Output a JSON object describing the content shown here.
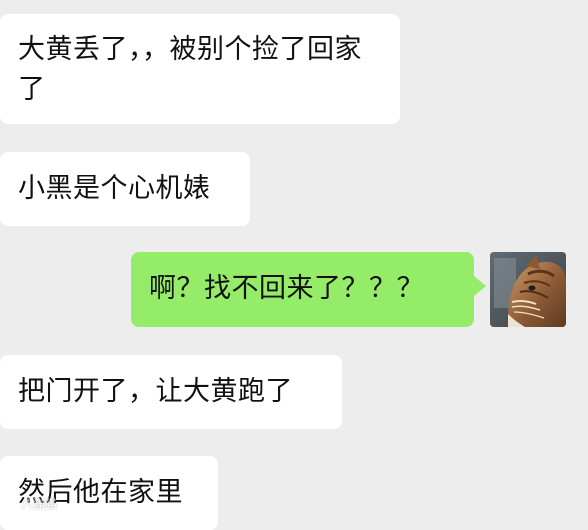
{
  "messages": [
    {
      "id": "m1",
      "sender": "other",
      "text": "大黄丢了，，被别个捡了回家了"
    },
    {
      "id": "m2",
      "sender": "other",
      "text": "小黑是个心机婊"
    },
    {
      "id": "m3",
      "sender": "me",
      "text": "啊？找不回来了？？？"
    },
    {
      "id": "m4",
      "sender": "other",
      "text": "把门开了，让大黄跑了"
    },
    {
      "id": "m5",
      "sender": "other",
      "text": "然后他在家里"
    }
  ],
  "colors": {
    "background": "#ededed",
    "received_bubble": "#ffffff",
    "sent_bubble": "#95ec69",
    "text": "#111111"
  },
  "avatar": {
    "icon": "cat-photo-icon"
  },
  "watermark": {
    "icon": "weibo-watermark-icon",
    "text": "八猫猫"
  }
}
